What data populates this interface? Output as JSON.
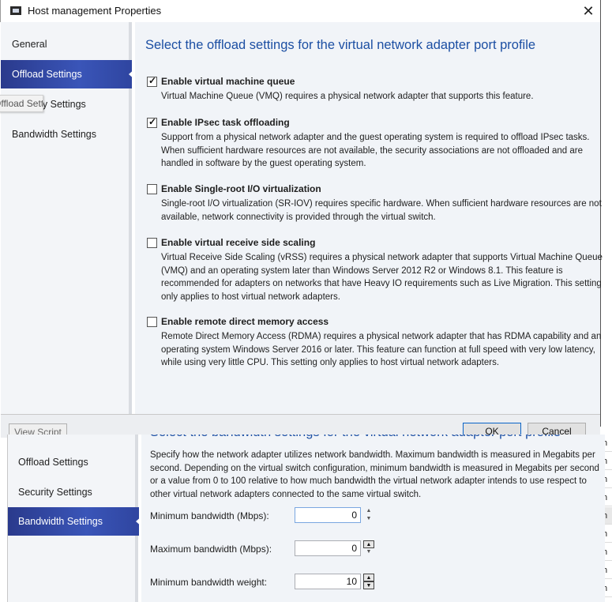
{
  "window": {
    "title": "Host management Properties",
    "close_icon": "close-icon"
  },
  "nav": {
    "items": [
      {
        "label": "General",
        "active": false
      },
      {
        "label": "Offload Settings",
        "active": true
      },
      {
        "label": "Security Settings",
        "active": false
      },
      {
        "label": "Bandwidth Settings",
        "active": false
      }
    ],
    "tooltip": "Offload Settings"
  },
  "offload": {
    "heading": "Select the offload settings for the virtual network adapter port profile",
    "options": [
      {
        "label": "Enable virtual machine queue",
        "checked": true,
        "description": "Virtual Machine Queue (VMQ) requires a physical network adapter that supports this feature."
      },
      {
        "label": "Enable IPsec task offloading",
        "checked": true,
        "description": "Support from a physical network adapter and the guest operating system is required to offload IPsec tasks. When sufficient hardware resources are not available, the security associations are not offloaded and are handled in software by the guest operating system."
      },
      {
        "label": "Enable Single-root I/O virtualization",
        "checked": false,
        "description": "Single-root I/O virtualization (SR-IOV) requires specific hardware. When sufficient hardware resources are not available, network connectivity is provided through the virtual switch."
      },
      {
        "label": "Enable virtual receive side scaling",
        "checked": false,
        "description": "Virtual Receive Side Scaling (vRSS) requires a physical network adapter that supports Virtual Machine Queue (VMQ) and an operating system later than Windows Server 2012 R2 or Windows 8.1. This feature is recommended for adapters on networks that have Heavy IO requirements such as Live Migration. This setting only applies to host virtual network adapters."
      },
      {
        "label": "Enable remote direct memory access",
        "checked": false,
        "description": "Remote Direct Memory Access (RDMA) requires a physical network adapter that has RDMA capability and an operating system Windows Server 2016 or later. This feature can function at full speed with very low latency, while using very little CPU. This setting only applies to host virtual network adapters."
      }
    ]
  },
  "footer": {
    "view_script": "View Script",
    "ok": "OK",
    "cancel": "Cancel"
  },
  "overlay": {
    "nav": [
      {
        "label": "Offload Settings",
        "active": false
      },
      {
        "label": "Security Settings",
        "active": false
      },
      {
        "label": "Bandwidth Settings",
        "active": true
      }
    ],
    "heading": "Select the bandwidth settings for the virtual network adapter port profile",
    "description": "Specify how the network adapter utilizes network bandwidth. Maximum bandwidth is measured in Megabits per second. Depending on the virtual switch configuration, minimum bandwidth is measured in Megabits per second or a value from 0 to 100 relative to how much bandwidth the virtual network adapter intends to use respect to other virtual network adapters connected to the same virtual switch.",
    "fields": [
      {
        "label": "Minimum bandwidth (Mbps):",
        "value": "0"
      },
      {
        "label": "Maximum bandwidth (Mbps):",
        "value": "0"
      },
      {
        "label": "Minimum bandwidth weight:",
        "value": "10"
      }
    ]
  },
  "background_list": {
    "rows": [
      "th",
      "th",
      "th",
      "th",
      "th",
      "th",
      "th",
      "th",
      "th"
    ]
  }
}
